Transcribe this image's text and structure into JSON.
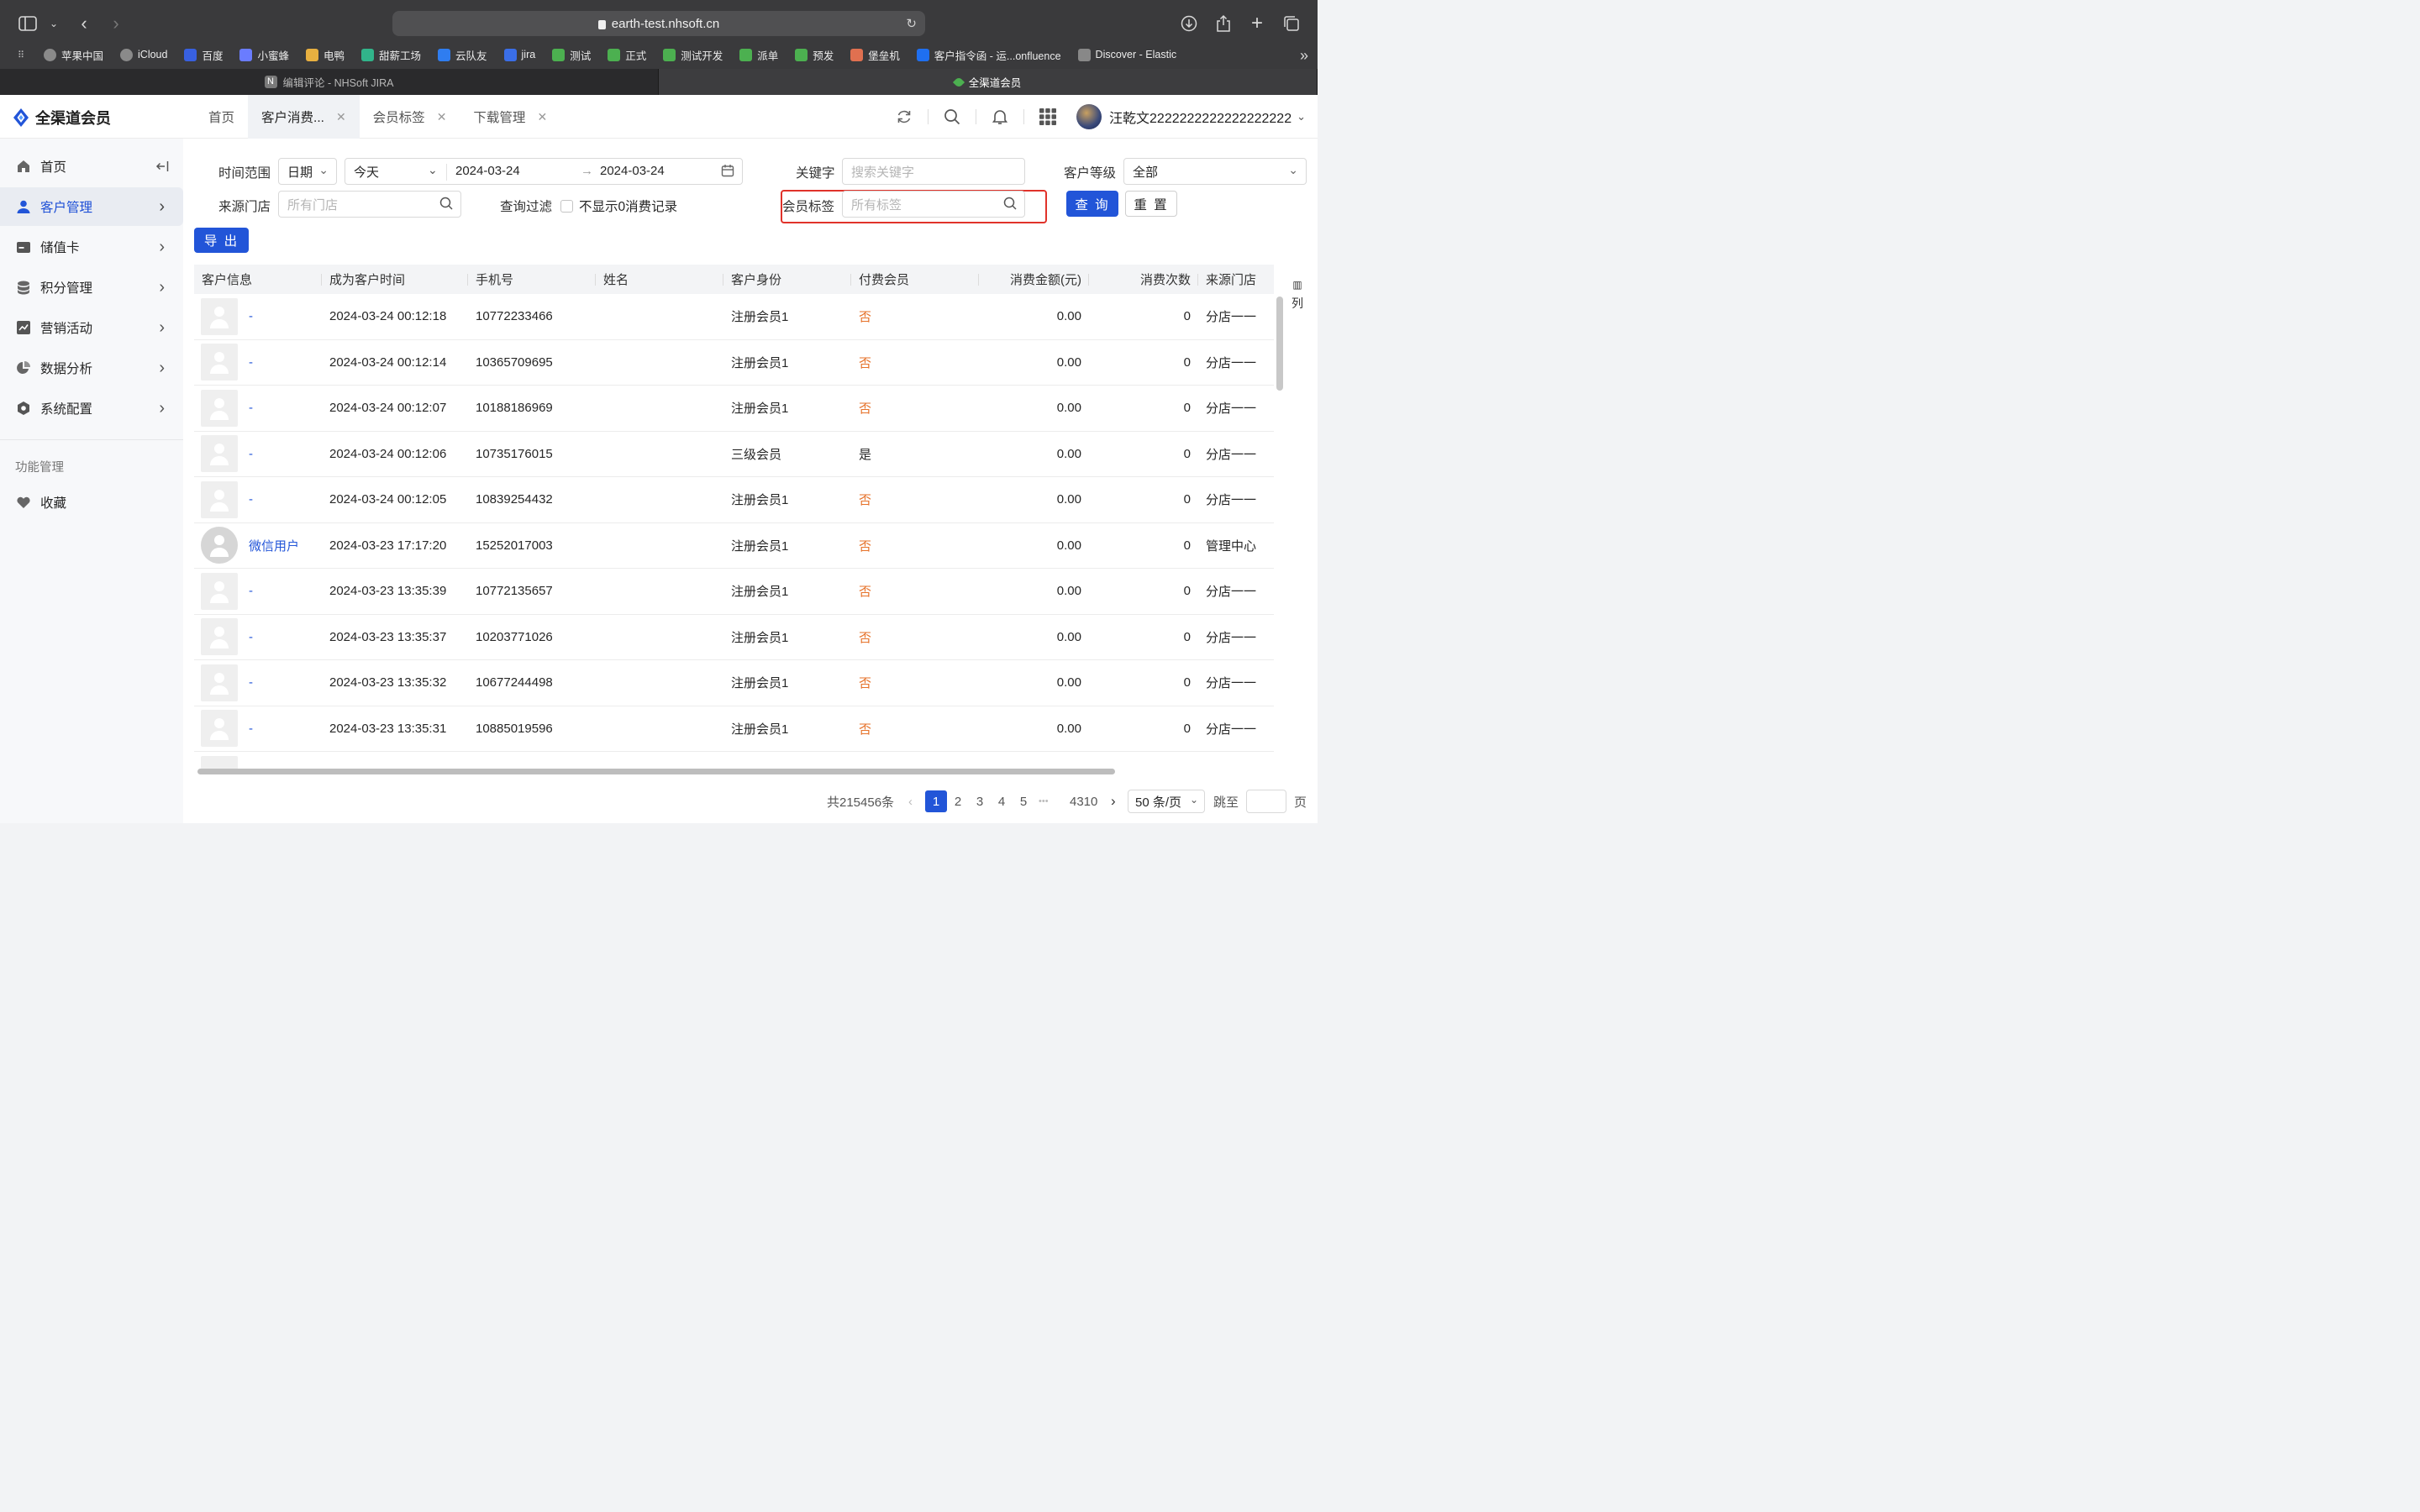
{
  "browser": {
    "url": "earth-test.nhsoft.cn",
    "bookmarks": [
      "苹果中国",
      "iCloud",
      "百度",
      "小蜜蜂",
      "电鸭",
      "甜薪工场",
      "云队友",
      "jira",
      "测试",
      "正式",
      "测试开发",
      "派单",
      "预发",
      "堡垒机",
      "客户指令函 - 运...onfluence",
      "Discover - Elastic"
    ],
    "bookmark_colors": [
      "#8a8a8a",
      "#8a8a8a",
      "#3860e0",
      "#6a7cff",
      "#e8b040",
      "#31b48a",
      "#2f7df0",
      "#3a6ee8",
      "#4cb050",
      "#4cb050",
      "#4cb050",
      "#4cb050",
      "#4cb050",
      "#e07050",
      "#1f6ff0",
      "#888888"
    ],
    "tabs": [
      {
        "label": "编辑评论 - NHSoft JIRA",
        "active": false
      },
      {
        "label": "全渠道会员",
        "active": true
      }
    ]
  },
  "header": {
    "app_name": "全渠道会员",
    "tabs": [
      {
        "label": "首页",
        "closable": false,
        "active": false
      },
      {
        "label": "客户消费...",
        "closable": true,
        "active": true
      },
      {
        "label": "会员标签",
        "closable": true,
        "active": false
      },
      {
        "label": "下载管理",
        "closable": true,
        "active": false
      }
    ],
    "user_name": "汪乾文2222222222222222222"
  },
  "sidebar": {
    "items": [
      {
        "label": "首页",
        "icon": "home-icon",
        "color": "#666666",
        "active": false,
        "has_arrow": false
      },
      {
        "label": "客户管理",
        "icon": "user-icon",
        "color": "#2255d8",
        "active": true,
        "has_arrow": true
      },
      {
        "label": "储值卡",
        "icon": "card-icon",
        "color": "#555555",
        "active": false,
        "has_arrow": true
      },
      {
        "label": "积分管理",
        "icon": "coins-icon",
        "color": "#666666",
        "active": false,
        "has_arrow": true
      },
      {
        "label": "营销活动",
        "icon": "chart-icon",
        "color": "#555555",
        "active": false,
        "has_arrow": true
      },
      {
        "label": "数据分析",
        "icon": "pie-icon",
        "color": "#666666",
        "active": false,
        "has_arrow": true
      },
      {
        "label": "系统配置",
        "icon": "settings-icon",
        "color": "#555555",
        "active": false,
        "has_arrow": true
      }
    ],
    "section_label": "功能管理",
    "favorites_label": "收藏"
  },
  "filters": {
    "time_range_label": "时间范围",
    "date_type": "日期",
    "preset": "今天",
    "start_date": "2024-03-24",
    "end_date": "2024-03-24",
    "keyword_label": "关键字",
    "keyword_placeholder": "搜索关键字",
    "level_label": "客户等级",
    "level_value": "全部",
    "store_label": "来源门店",
    "store_placeholder": "所有门店",
    "filter_label": "查询过滤",
    "hide_zero_label": "不显示0消费记录",
    "tag_label": "会员标签",
    "tag_placeholder": "所有标签",
    "query_button": "查 询",
    "reset_button": "重 置",
    "export_button": "导 出"
  },
  "table": {
    "columns": [
      "客户信息",
      "成为客户时间",
      "手机号",
      "姓名",
      "客户身份",
      "付费会员",
      "消费金额(元)",
      "消费次数",
      "来源门店"
    ],
    "column_tool_label": "列",
    "rows": [
      {
        "name": "-",
        "wechat": false,
        "time": "2024-03-24 00:12:18",
        "phone": "10772233466",
        "real_name": "",
        "identity": "注册会员1",
        "paid": "否",
        "amount": "0.00",
        "count": "0",
        "store": "分店一一"
      },
      {
        "name": "-",
        "wechat": false,
        "time": "2024-03-24 00:12:14",
        "phone": "10365709695",
        "real_name": "",
        "identity": "注册会员1",
        "paid": "否",
        "amount": "0.00",
        "count": "0",
        "store": "分店一一"
      },
      {
        "name": "-",
        "wechat": false,
        "time": "2024-03-24 00:12:07",
        "phone": "10188186969",
        "real_name": "",
        "identity": "注册会员1",
        "paid": "否",
        "amount": "0.00",
        "count": "0",
        "store": "分店一一"
      },
      {
        "name": "-",
        "wechat": false,
        "time": "2024-03-24 00:12:06",
        "phone": "10735176015",
        "real_name": "",
        "identity": "三级会员",
        "paid": "是",
        "amount": "0.00",
        "count": "0",
        "store": "分店一一"
      },
      {
        "name": "-",
        "wechat": false,
        "time": "2024-03-24 00:12:05",
        "phone": "10839254432",
        "real_name": "",
        "identity": "注册会员1",
        "paid": "否",
        "amount": "0.00",
        "count": "0",
        "store": "分店一一"
      },
      {
        "name": "微信用户",
        "wechat": true,
        "time": "2024-03-23 17:17:20",
        "phone": "15252017003",
        "real_name": "",
        "identity": "注册会员1",
        "paid": "否",
        "amount": "0.00",
        "count": "0",
        "store": "管理中心"
      },
      {
        "name": "-",
        "wechat": false,
        "time": "2024-03-23 13:35:39",
        "phone": "10772135657",
        "real_name": "",
        "identity": "注册会员1",
        "paid": "否",
        "amount": "0.00",
        "count": "0",
        "store": "分店一一"
      },
      {
        "name": "-",
        "wechat": false,
        "time": "2024-03-23 13:35:37",
        "phone": "10203771026",
        "real_name": "",
        "identity": "注册会员1",
        "paid": "否",
        "amount": "0.00",
        "count": "0",
        "store": "分店一一"
      },
      {
        "name": "-",
        "wechat": false,
        "time": "2024-03-23 13:35:32",
        "phone": "10677244498",
        "real_name": "",
        "identity": "注册会员1",
        "paid": "否",
        "amount": "0.00",
        "count": "0",
        "store": "分店一一"
      },
      {
        "name": "-",
        "wechat": false,
        "time": "2024-03-23 13:35:31",
        "phone": "10885019596",
        "real_name": "",
        "identity": "注册会员1",
        "paid": "否",
        "amount": "0.00",
        "count": "0",
        "store": "分店一一"
      }
    ]
  },
  "pagination": {
    "total_label": "共215456条",
    "pages": [
      "1",
      "2",
      "3",
      "4",
      "5"
    ],
    "ellipsis": "•••",
    "last_page": "4310",
    "current": "1",
    "page_size": "50 条/页",
    "jump_label": "跳至",
    "page_suffix": "页"
  },
  "colors": {
    "primary": "#2255d8",
    "warning": "#e6722a",
    "highlight": "#e0322a"
  }
}
